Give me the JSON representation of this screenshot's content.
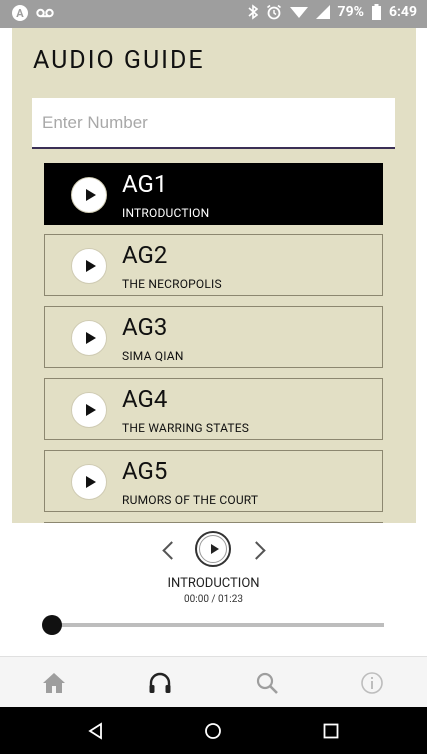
{
  "status_bar": {
    "battery": "79%",
    "time": "6:49"
  },
  "header": {
    "title": "AUDIO GUIDE"
  },
  "search": {
    "placeholder": "Enter Number",
    "value": ""
  },
  "guides": [
    {
      "code": "AG1",
      "name": "INTRODUCTION",
      "active": true
    },
    {
      "code": "AG2",
      "name": "THE NECROPOLIS",
      "active": false
    },
    {
      "code": "AG3",
      "name": "SIMA QIAN",
      "active": false
    },
    {
      "code": "AG4",
      "name": "THE WARRING STATES",
      "active": false
    },
    {
      "code": "AG5",
      "name": "RUMORS OF THE COURT",
      "active": false
    }
  ],
  "player": {
    "now_playing": "INTRODUCTION",
    "time": "00:00 / 01:23",
    "progress": 0
  },
  "tabs": [
    {
      "icon": "home-icon"
    },
    {
      "icon": "headphones-icon"
    },
    {
      "icon": "search-icon"
    },
    {
      "icon": "info-icon"
    }
  ]
}
